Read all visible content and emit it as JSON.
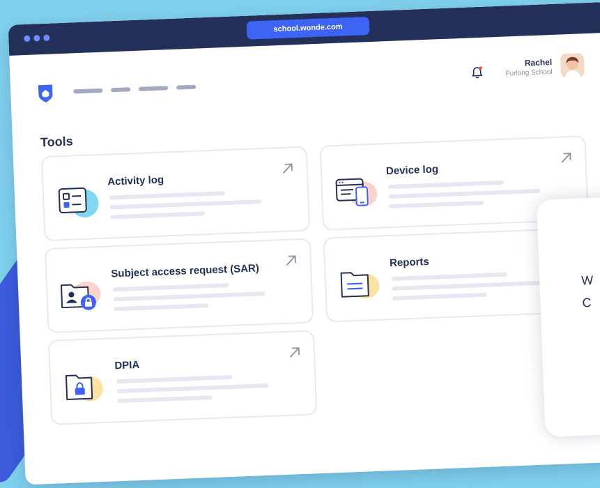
{
  "browser": {
    "url": "school.wonde.com"
  },
  "header": {
    "user_name": "Rachel",
    "user_school": "Furlong School"
  },
  "page": {
    "title": "Tools"
  },
  "tools": [
    {
      "title": "Activity log",
      "icon": "activity-log-icon"
    },
    {
      "title": "Device log",
      "icon": "device-log-icon"
    },
    {
      "title": "Subject access request (SAR)",
      "icon": "sar-folder-icon"
    },
    {
      "title": "Reports",
      "icon": "reports-folder-icon"
    },
    {
      "title": "DPIA",
      "icon": "dpia-folder-icon"
    }
  ],
  "overlay": {
    "line1": "W",
    "line2": "C"
  },
  "colors": {
    "background": "#7fd0ec",
    "topbar": "#23305a",
    "url_bar": "#3d64f5",
    "brand_blue": "#3d64f5",
    "text_dark": "#23305a",
    "notification_dot": "#ff5a3c"
  }
}
